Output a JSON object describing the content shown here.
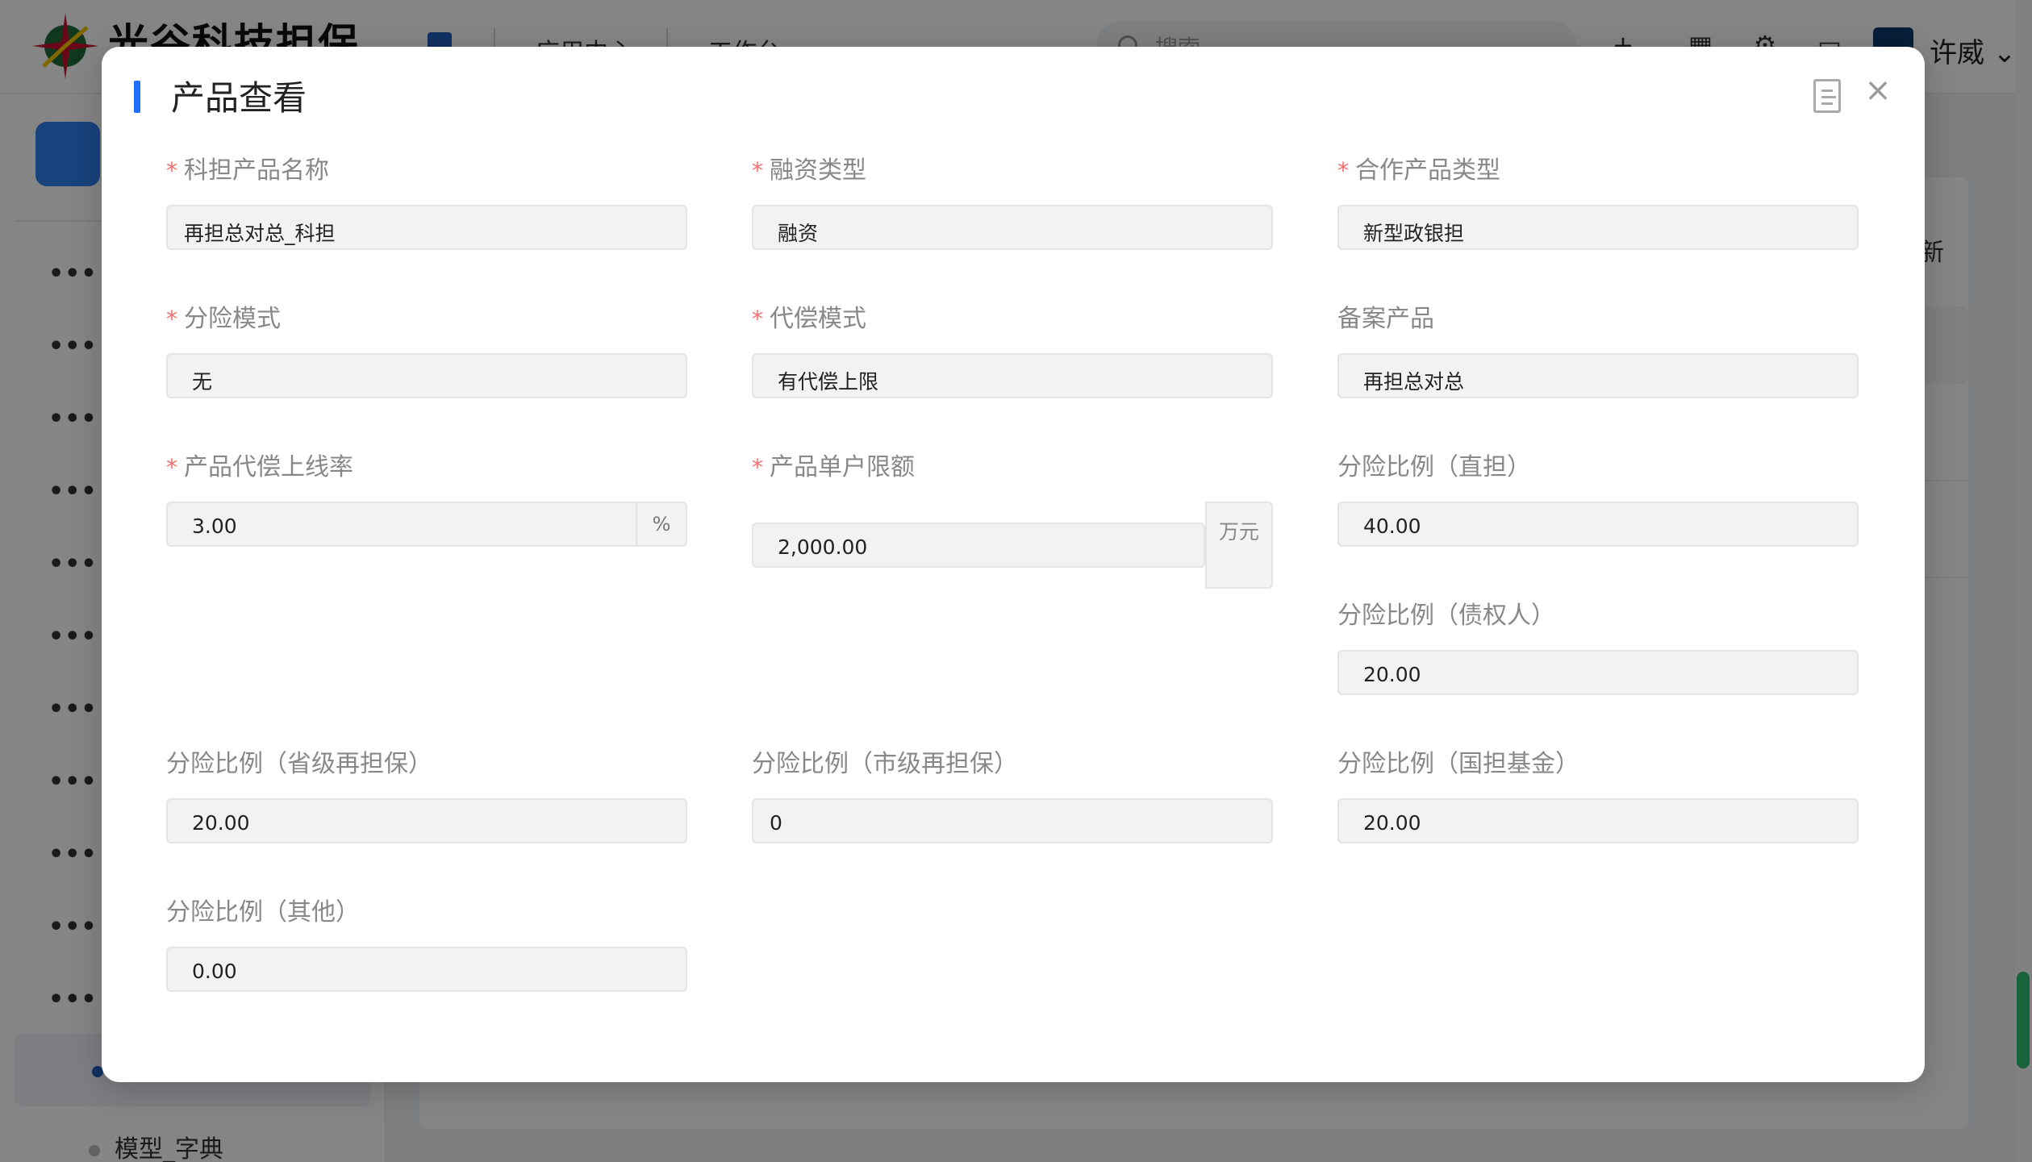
{
  "app": {
    "brand": "光谷科技担保",
    "nav_links": [
      "应用中心",
      "工作台"
    ],
    "search_placeholder": "搜索",
    "user_name": "许威",
    "sidebar_sub_item": "模型_字典",
    "content_new_label": "新"
  },
  "modal": {
    "title": "产品查看",
    "fields": {
      "product_name": {
        "label": "科担产品名称",
        "required": true,
        "value": "再担总对总_科担"
      },
      "financing_type": {
        "label": "融资类型",
        "required": true,
        "value": "融资"
      },
      "coop_product_type": {
        "label": "合作产品类型",
        "required": true,
        "value": "新型政银担"
      },
      "risk_mode": {
        "label": "分险模式",
        "required": true,
        "value": "无"
      },
      "compensation_mode": {
        "label": "代偿模式",
        "required": true,
        "value": "有代偿上限"
      },
      "filed_product": {
        "label": "备案产品",
        "required": false,
        "value": "再担总对总"
      },
      "compensation_cap_rate": {
        "label": "产品代偿上线率",
        "required": true,
        "value": "3.00",
        "suffix": "%"
      },
      "single_limit": {
        "label": "产品单户限额",
        "required": true,
        "value": "2,000.00",
        "suffix": "万元"
      },
      "ratio_direct": {
        "label": "分险比例（直担）",
        "required": false,
        "value": "40.00"
      },
      "ratio_creditor": {
        "label": "分险比例（债权人）",
        "required": false,
        "value": "20.00"
      },
      "ratio_provincial": {
        "label": "分险比例（省级再担保）",
        "required": false,
        "value": "20.00"
      },
      "ratio_municipal": {
        "label": "分险比例（市级再担保）",
        "required": false,
        "value": "0"
      },
      "ratio_national": {
        "label": "分险比例（国担基金）",
        "required": false,
        "value": "20.00"
      },
      "ratio_other": {
        "label": "分险比例（其他）",
        "required": false,
        "value": "0.00"
      }
    }
  },
  "icons": {
    "close": "close-icon",
    "doc": "document-icon"
  },
  "colors": {
    "accent": "#1f6fff",
    "required": "#f56c6c"
  }
}
